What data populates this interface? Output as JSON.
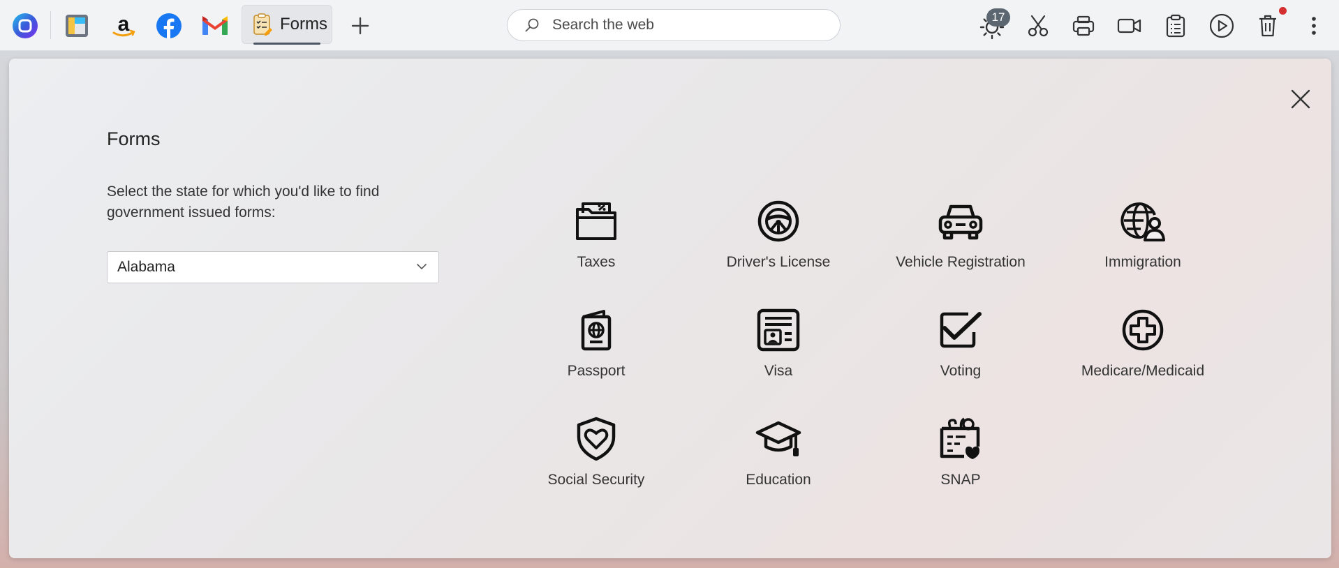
{
  "toolbar": {
    "active_tab_label": "Forms",
    "search_placeholder": "Search the web",
    "weather_badge": "17"
  },
  "panel": {
    "title": "Forms",
    "description": "Select the state for which you'd like to find government issued forms:",
    "state_select": {
      "selected": "Alabama"
    }
  },
  "forms": [
    {
      "label": "Taxes",
      "icon": "folder-percent-icon"
    },
    {
      "label": "Driver's License",
      "icon": "steering-wheel-icon"
    },
    {
      "label": "Vehicle Registration",
      "icon": "car-icon"
    },
    {
      "label": "Immigration",
      "icon": "globe-person-icon"
    },
    {
      "label": "Passport",
      "icon": "passport-icon"
    },
    {
      "label": "Visa",
      "icon": "id-card-icon"
    },
    {
      "label": "Voting",
      "icon": "checkbox-icon"
    },
    {
      "label": "Medicare/Medicaid",
      "icon": "plus-circle-icon"
    },
    {
      "label": "Social Security",
      "icon": "shield-heart-icon"
    },
    {
      "label": "Education",
      "icon": "graduation-cap-icon"
    },
    {
      "label": "SNAP",
      "icon": "grocery-basket-icon"
    }
  ],
  "colors": {
    "toolbar_bg": "#f2f3f5",
    "badge_bg": "#5c6670",
    "notification_dot": "#d32f2f",
    "icon_stroke": "#111111"
  }
}
